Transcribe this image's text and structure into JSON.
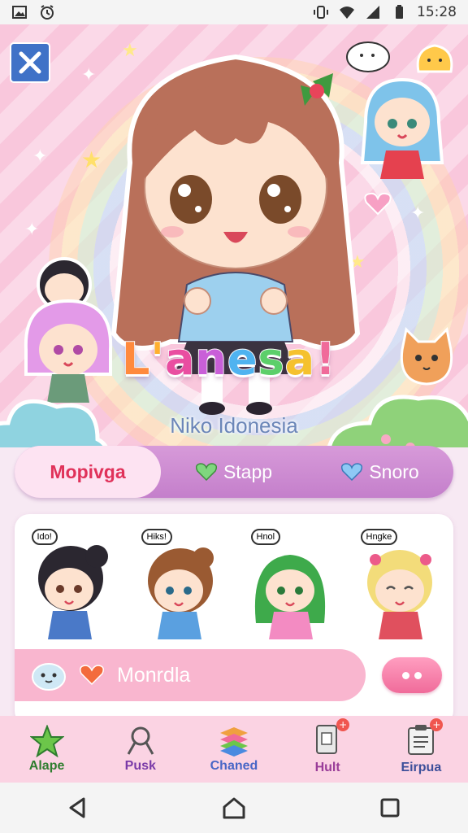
{
  "status_bar": {
    "time": "15:28",
    "icons": [
      "image-icon",
      "alarm-icon",
      "vibrate-icon",
      "wifi-icon",
      "signal-icon",
      "battery-icon"
    ]
  },
  "hero": {
    "title": "L'anesa!",
    "subtitle": "Niko Idonesia",
    "title_colors": [
      "#ff8a3d",
      "#ffb02e",
      "#e94ea1",
      "#c95fd8",
      "#4fb3f0",
      "#5ccf6a",
      "#f5c12e",
      "#f06b9a"
    ]
  },
  "tabs": [
    {
      "label": "Mopivga",
      "icon": "",
      "active": true
    },
    {
      "label": "Stapp",
      "icon": "green-heart-icon",
      "active": false
    },
    {
      "label": "Snoro",
      "icon": "blue-heart-icon",
      "active": false
    }
  ],
  "stickers": [
    {
      "bubble": "Ido!",
      "hair": "#2b2730",
      "dress": "#4a79c8"
    },
    {
      "bubble": "Hiks!",
      "hair": "#9a5a32",
      "dress": "#5aa0e0"
    },
    {
      "bubble": "Hnol",
      "hair": "#3eaa4b",
      "dress": "#f38bc2"
    },
    {
      "bubble": "Hngke",
      "hair": "#f3dc7a",
      "dress": "#e0505e"
    }
  ],
  "message_bar": {
    "text": "Monrdla"
  },
  "bottom_nav": [
    {
      "label": "Alape",
      "color": "#2f7d2f",
      "icon": "star-icon"
    },
    {
      "label": "Pusk",
      "color": "#7a3aa8",
      "icon": "search-icon"
    },
    {
      "label": "Chaned",
      "color": "#4866c6",
      "icon": "layers-icon"
    },
    {
      "label": "Hult",
      "color": "#9a3d99",
      "icon": "phone-icon",
      "badge": "+"
    },
    {
      "label": "Eirpua",
      "color": "#3d4f9a",
      "icon": "clipboard-icon",
      "badge": "+"
    }
  ],
  "colors": {
    "accent": "#f06b9a",
    "tab_bar": "#c47fcb",
    "active_tab_text": "#e0325a",
    "nav_bg": "#fbd3e3"
  }
}
